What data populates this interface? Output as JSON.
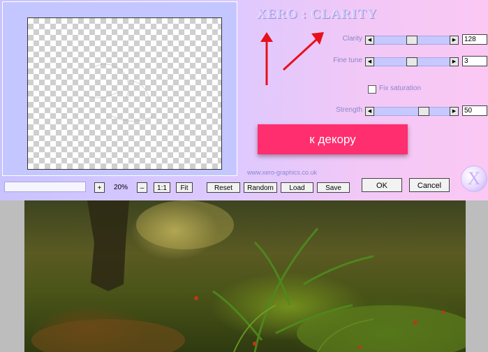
{
  "plugin": {
    "title": "XERO : CLARITY",
    "website": "www.xero-graphics.co.uk",
    "logo_letter": "X"
  },
  "params": {
    "clarity": {
      "label": "Clarity",
      "value": "128",
      "slider_fraction": 0.5
    },
    "fine_tune": {
      "label": "Fine tune",
      "value": "3",
      "slider_fraction": 0.5
    },
    "fix_saturation": {
      "label": "Fix saturation",
      "checked": false
    },
    "strength": {
      "label": "Strength",
      "value": "50",
      "slider_fraction": 0.69
    }
  },
  "decor_button": {
    "label": "к декору"
  },
  "preview_controls": {
    "zoom_in": "+",
    "zoom_value": "20%",
    "zoom_out": "–",
    "one_to_one": "1:1",
    "fit": "Fit"
  },
  "actions": {
    "reset": "Reset",
    "random": "Random",
    "load": "Load",
    "save": "Save",
    "ok": "OK",
    "cancel": "Cancel"
  },
  "slider_arrows": {
    "left": "◀",
    "right": "▶"
  },
  "colors": {
    "accent_button": "#ff2e6e",
    "arrow_red": "#e8101c",
    "label_text": "#8a86c8"
  }
}
